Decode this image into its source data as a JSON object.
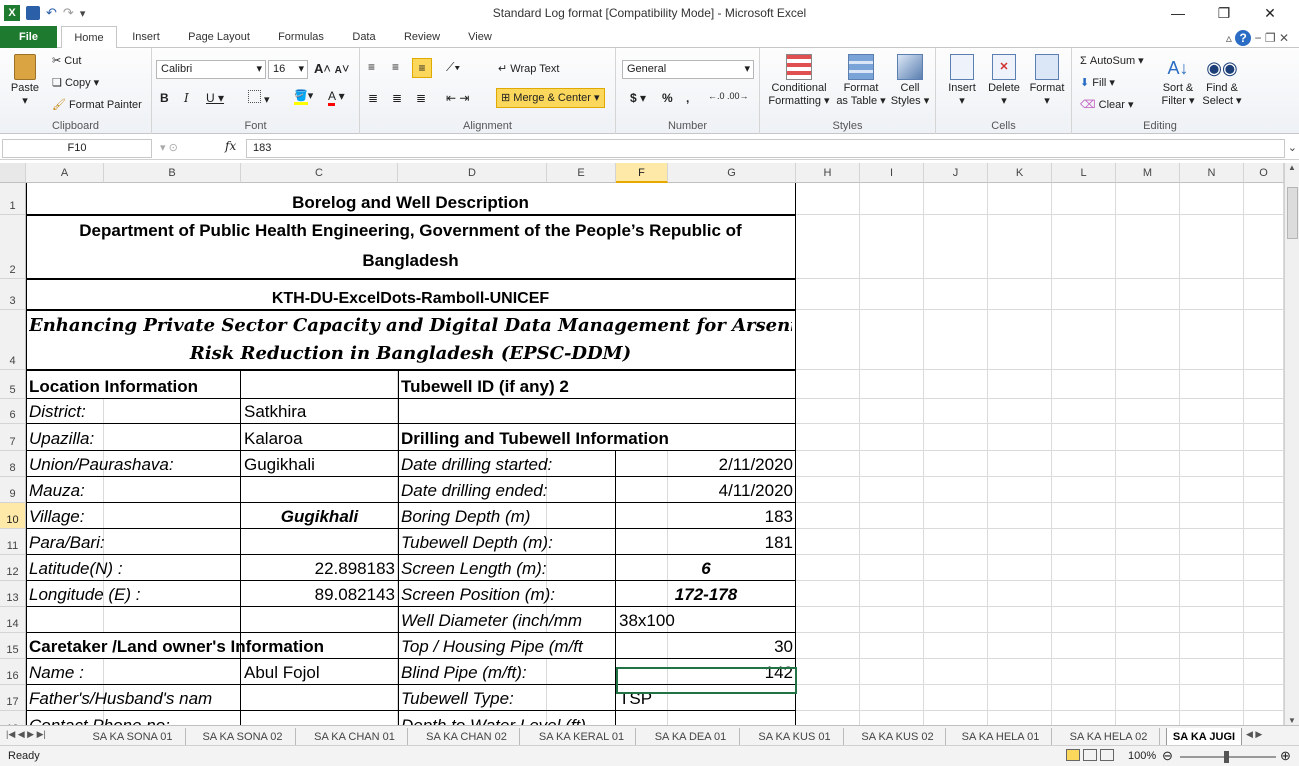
{
  "window": {
    "title": "Standard Log format  [Compatibility Mode]  -  Microsoft Excel"
  },
  "ribbon_tabs": [
    {
      "label": "File"
    },
    {
      "label": "Home"
    },
    {
      "label": "Insert"
    },
    {
      "label": "Page Layout"
    },
    {
      "label": "Formulas"
    },
    {
      "label": "Data"
    },
    {
      "label": "Review"
    },
    {
      "label": "View"
    }
  ],
  "clipboard": {
    "paste": "Paste",
    "cut": "Cut",
    "copy": "Copy",
    "format_painter": "Format Painter",
    "label": "Clipboard"
  },
  "font": {
    "name": "Calibri",
    "size": "16",
    "label": "Font"
  },
  "alignment": {
    "wrap": "Wrap Text",
    "merge": "Merge & Center",
    "label": "Alignment"
  },
  "number": {
    "format": "General",
    "label": "Number",
    "currency": "$",
    "percent": "%",
    "comma": ","
  },
  "styles": {
    "cond": [
      "Conditional",
      "Formatting"
    ],
    "table": [
      "Format",
      "as Table"
    ],
    "cell": [
      "Cell",
      "Styles"
    ],
    "label": "Styles"
  },
  "cells": {
    "insert": "Insert",
    "delete": "Delete",
    "format": "Format",
    "label": "Cells"
  },
  "editing": {
    "autosum": "AutoSum",
    "fill": "Fill",
    "clear": "Clear",
    "sort": [
      "Sort &",
      "Filter"
    ],
    "find": [
      "Find &",
      "Select"
    ],
    "label": "Editing"
  },
  "formula_bar": {
    "name_box": "F10",
    "fx": "fx",
    "value": "183"
  },
  "columns": [
    "A",
    "B",
    "C",
    "D",
    "E",
    "F",
    "G",
    "H",
    "I",
    "J",
    "K",
    "L",
    "M",
    "N",
    "O"
  ],
  "rows": [
    "1",
    "2",
    "3",
    "4",
    "5",
    "6",
    "7",
    "8",
    "9",
    "10",
    "11",
    "12",
    "13",
    "14",
    "15",
    "16",
    "17",
    "18"
  ],
  "cells_data": {
    "r1": "Borelog and Well Description",
    "r2a": "Department of Public Health Engineering, Government of the People’s Republic of",
    "r2b": "Bangladesh",
    "r3": "KTH-DU-ExcelDots-Ramboll-UNICEF",
    "r4a": "Enhancing Private Sector Capacity and Digital Data Management for Arsenic",
    "r4b": "Risk Reduction in Bangladesh (EPSC-DDM)",
    "a5": "Location Information",
    "d5": "Tubewell ID (if any) 2",
    "a6": "District:",
    "c6": "Satkhira",
    "a7": "Upazilla:",
    "c7": "Kalaroa",
    "d7": "Drilling and Tubewell Information",
    "a8": "Union/Paurashava:",
    "c8": "Gugikhali",
    "d8": "Date drilling started:",
    "f8": "2/11/2020",
    "a9": "Mauza:",
    "d9": "Date drilling ended:",
    "f9": "4/11/2020",
    "a10": "Village:",
    "c10": "Gugikhali",
    "d10": "Boring Depth (m)",
    "f10": "183",
    "a11": "Para/Bari:",
    "d11": "Tubewell Depth (m):",
    "f11": "181",
    "a12": "Latitude(N) :",
    "c12": "22.898183",
    "d12": "Screen Length (m):",
    "f12": "6",
    "a13": "Longitude (E) :",
    "c13": "89.082143",
    "d13": "Screen Position (m):",
    "f13": "172-178",
    "d14": "Well Diameter (inch/mm",
    "f14": "38x100",
    "a15": "Caretaker /Land owner's Information",
    "d15": "Top / Housing Pipe (m/ft",
    "f15": "30",
    "a16": "Name :",
    "c16": "Abul Fojol",
    "d16": "Blind Pipe (m/ft):",
    "f16": "142",
    "a17": "Father's/Husband's nam",
    "d17": "Tubewell Type:",
    "f17": "TSP",
    "a18": "Contact Phone no:",
    "d18": "Depth to Water Level (ft)"
  },
  "sheets": [
    "SA KA SONA 01",
    "SA KA SONA 02",
    "SA KA CHAN 01",
    "SA KA CHAN 02",
    "SA KA KERAL 01",
    "SA KA DEA 01",
    "SA KA KUS 01",
    "SA KA KUS 02",
    "SA KA HELA 01",
    "SA KA HELA 02",
    "SA KA JUGI"
  ],
  "status": {
    "ready": "Ready",
    "zoom": "100%"
  }
}
